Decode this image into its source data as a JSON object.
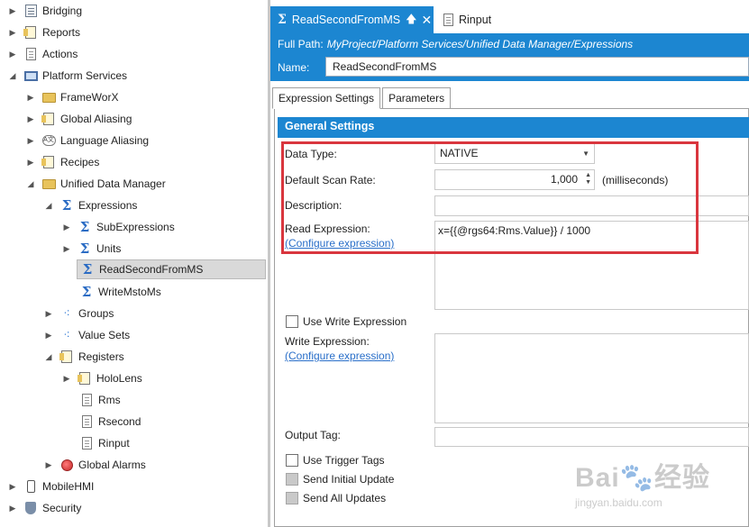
{
  "tree": {
    "items": [
      {
        "label": "Bridging",
        "icon": "doc-box-icon",
        "arrow": "▶"
      },
      {
        "label": "Reports",
        "icon": "report-icon",
        "arrow": "▶"
      },
      {
        "label": "Actions",
        "icon": "actions-icon",
        "arrow": "▶"
      },
      {
        "label": "Platform Services",
        "icon": "monitor-icon",
        "arrow": "◢"
      },
      {
        "label": "FrameWorX",
        "icon": "folder-icon",
        "arrow": "▶"
      },
      {
        "label": "Global Aliasing",
        "icon": "aliasing-icon",
        "arrow": "▶"
      },
      {
        "label": "Language Aliasing",
        "icon": "language-icon",
        "arrow": "▶"
      },
      {
        "label": "Recipes",
        "icon": "recipes-icon",
        "arrow": "▶"
      },
      {
        "label": "Unified Data Manager",
        "icon": "folder-icon",
        "arrow": "◢"
      },
      {
        "label": "Expressions",
        "icon": "sigma-icon",
        "arrow": "◢"
      },
      {
        "label": "SubExpressions",
        "icon": "sigma-icon",
        "arrow": "▶"
      },
      {
        "label": "Units",
        "icon": "sigma-icon",
        "arrow": "▶"
      },
      {
        "label": "ReadSecondFromMS",
        "icon": "sigma-icon",
        "arrow": ""
      },
      {
        "label": "WriteMstoMs",
        "icon": "sigma-icon",
        "arrow": ""
      },
      {
        "label": "Groups",
        "icon": "groups-icon",
        "arrow": "▶"
      },
      {
        "label": "Value Sets",
        "icon": "value-sets-icon",
        "arrow": "▶"
      },
      {
        "label": "Registers",
        "icon": "registers-icon",
        "arrow": "◢"
      },
      {
        "label": "HoloLens",
        "icon": "register-folder-icon",
        "arrow": "▶"
      },
      {
        "label": "Rms",
        "icon": "register-icon",
        "arrow": ""
      },
      {
        "label": "Rsecond",
        "icon": "register-icon",
        "arrow": ""
      },
      {
        "label": "Rinput",
        "icon": "register-icon",
        "arrow": ""
      },
      {
        "label": "Global Alarms",
        "icon": "alarms-icon",
        "arrow": "▶"
      },
      {
        "label": "MobileHMI",
        "icon": "mobile-icon",
        "arrow": "▶"
      },
      {
        "label": "Security",
        "icon": "shield-icon",
        "arrow": "▶"
      }
    ]
  },
  "tabs": {
    "active_label": "ReadSecondFromMS",
    "pin_glyph": "🡅",
    "close_glyph": "✕",
    "other_label": "Rinput"
  },
  "header": {
    "fullpath_label": "Full Path:",
    "fullpath_value": "MyProject/Platform Services/Unified Data Manager/Expressions",
    "name_label": "Name:",
    "name_value": "ReadSecondFromMS"
  },
  "subtabs": [
    "Expression Settings",
    "Parameters"
  ],
  "general": {
    "title": "General Settings",
    "data_type_label": "Data Type:",
    "data_type_value": "NATIVE",
    "scan_rate_label": "Default Scan Rate:",
    "scan_rate_value": "1,000",
    "scan_rate_unit": "(milliseconds)",
    "description_label": "Description:",
    "description_value": "",
    "read_expr_label": "Read Expression:",
    "read_expr_value": "x={{@rgs64:Rms.Value}} / 1000",
    "configure_link": "(Configure expression)",
    "use_write_label": "Use Write Expression",
    "write_expr_label": "Write Expression:",
    "write_expr_value": "",
    "output_tag_label": "Output Tag:",
    "output_tag_value": "",
    "use_trigger_label": "Use Trigger Tags",
    "send_initial_label": "Send Initial Update",
    "send_all_label": "Send All Updates"
  },
  "watermark": {
    "main": "Bai🐾经验",
    "sub": "jingyan.baidu.com"
  },
  "colors": {
    "accent": "#1c86d1",
    "highlight": "#d9363e",
    "link": "#2a6fc9"
  }
}
